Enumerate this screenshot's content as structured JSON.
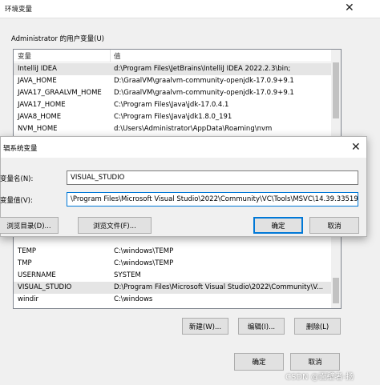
{
  "background_window": {
    "title": "环境变量",
    "user_section_label": "Administrator 的用户变量(U)",
    "user_table": {
      "headers": [
        "变量",
        "值"
      ],
      "rows": [
        {
          "name": "IntelliJ IDEA",
          "value": "d:\\Program Files\\JetBrains\\IntelliJ IDEA 2022.2.3\\bin;"
        },
        {
          "name": "JAVA_HOME",
          "value": "D:\\GraalVM\\graalvm-community-openjdk-17.0.9+9.1"
        },
        {
          "name": "JAVA17_GRAALVM_HOME",
          "value": "D:\\GraalVM\\graalvm-community-openjdk-17.0.9+9.1"
        },
        {
          "name": "JAVA17_HOME",
          "value": "C:\\Program Files\\Java\\jdk-17.0.4.1"
        },
        {
          "name": "JAVA8_HOME",
          "value": "C:\\Program Files\\Java\\jdk1.8.0_191"
        },
        {
          "name": "NVM_HOME",
          "value": "d:\\Users\\Administrator\\AppData\\Roaming\\nvm"
        }
      ]
    },
    "system_table": {
      "rows": [
        {
          "name": "TEMP",
          "value": "C:\\windows\\TEMP"
        },
        {
          "name": "TMP",
          "value": "C:\\windows\\TEMP"
        },
        {
          "name": "USERNAME",
          "value": "SYSTEM"
        },
        {
          "name": "VISUAL_STUDIO",
          "value": "D:\\Program Files\\Microsoft Visual Studio\\2022\\Community\\V..."
        },
        {
          "name": "windir",
          "value": "C:\\windows"
        }
      ]
    },
    "system_buttons": {
      "new": "新建(W)...",
      "edit": "编辑(I)...",
      "delete": "删除(L)"
    },
    "footer_buttons": {
      "ok": "确定",
      "cancel": "取消"
    }
  },
  "dialog": {
    "title": "辑系统变量",
    "name_label": "变量名(N):",
    "name_value": "VISUAL_STUDIO",
    "value_label": "变量值(V):",
    "value_value": "\\Program Files\\Microsoft Visual Studio\\2022\\Community\\VC\\Tools\\MSVC\\14.39.33519",
    "browse_dir": "浏览目录(D)...",
    "browse_file": "浏览文件(F)...",
    "ok": "确定",
    "cancel": "取消"
  },
  "watermark": "CSDN @面壁者-扬"
}
